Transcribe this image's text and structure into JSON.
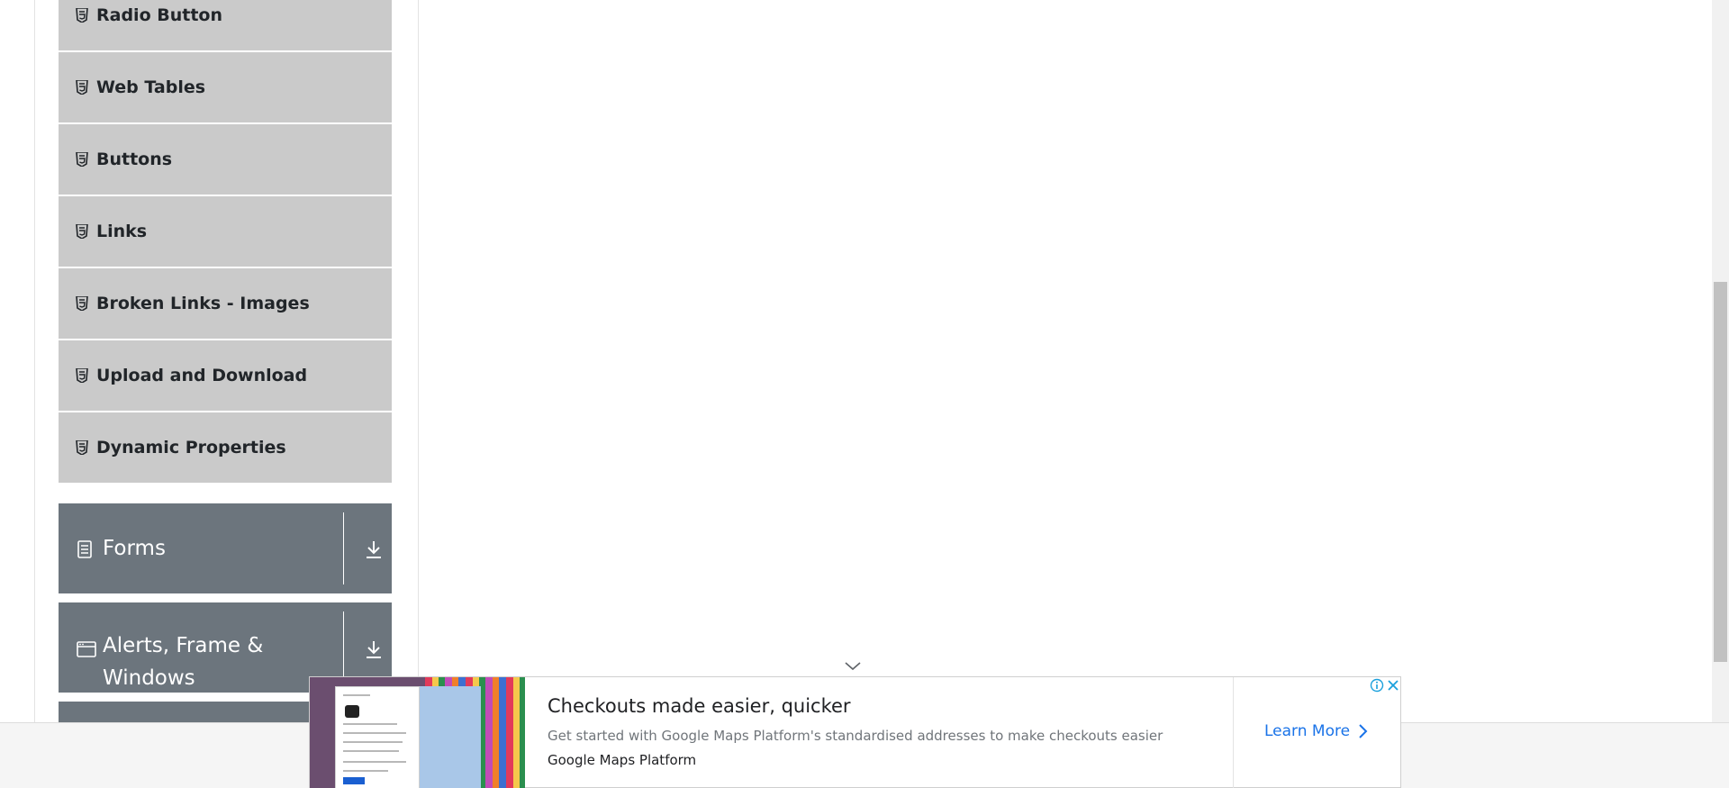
{
  "sidebar": {
    "items": [
      {
        "label": "Radio Button",
        "icon": "html5-icon"
      },
      {
        "label": "Web Tables",
        "icon": "html5-icon"
      },
      {
        "label": "Buttons",
        "icon": "html5-icon"
      },
      {
        "label": "Links",
        "icon": "html5-icon"
      },
      {
        "label": "Broken Links - Images",
        "icon": "html5-icon"
      },
      {
        "label": "Upload and Download",
        "icon": "html5-icon"
      },
      {
        "label": "Dynamic Properties",
        "icon": "html5-icon"
      }
    ],
    "groups": [
      {
        "label": "Forms",
        "icon": "document-icon",
        "action_icon": "download-arrow-icon"
      },
      {
        "label_line1": "Alerts, Frame &",
        "label_line2": "Windows",
        "icon": "window-icon",
        "action_icon": "download-arrow-icon"
      }
    ]
  },
  "ad": {
    "title": "Checkouts made easier, quicker",
    "description": "Get started with Google Maps Platform's standardised addresses to make checkouts easier",
    "brand": "Google Maps Platform",
    "cta_label": "Learn More",
    "icons": [
      "adchoices-icon",
      "close-icon",
      "chevron-right-icon"
    ]
  },
  "colors": {
    "menu_item_bg": "#cacaca",
    "group_bg": "#6c757d",
    "cta": "#1a73e8",
    "scroll_thumb": "#c1c1c1"
  }
}
